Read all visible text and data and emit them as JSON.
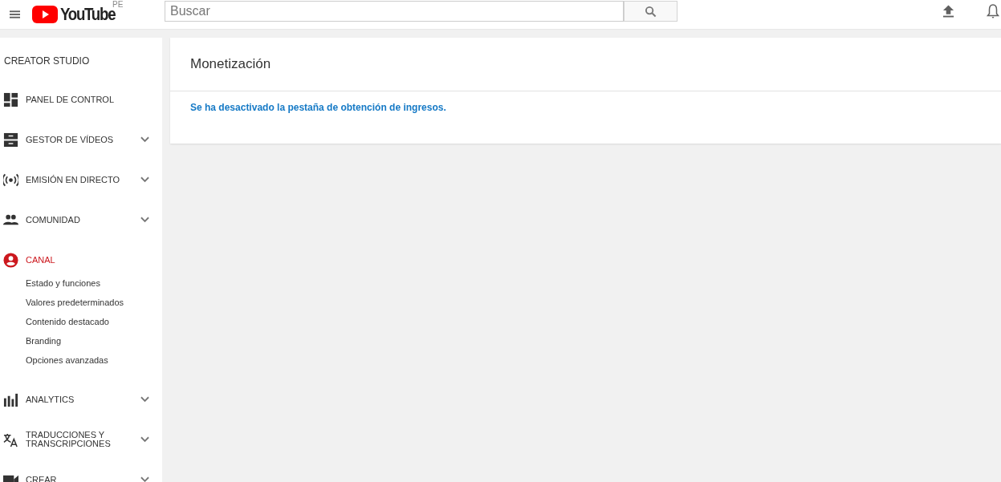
{
  "header": {
    "logo_text": "YouTube",
    "region": "PE",
    "search": {
      "placeholder": "Buscar"
    }
  },
  "sidebar": {
    "title": "CREATOR STUDIO",
    "items": [
      {
        "label": "PANEL DE CONTROL",
        "selected": false,
        "expandable": false
      },
      {
        "label": "GESTOR DE VÍDEOS",
        "selected": false,
        "expandable": true
      },
      {
        "label": "EMISIÓN EN DIRECTO",
        "selected": false,
        "expandable": true
      },
      {
        "label": "COMUNIDAD",
        "selected": false,
        "expandable": true
      },
      {
        "label": "CANAL",
        "selected": true,
        "expandable": false,
        "children": [
          {
            "label": "Estado y funciones"
          },
          {
            "label": "Valores predeterminados"
          },
          {
            "label": "Contenido destacado"
          },
          {
            "label": "Branding"
          },
          {
            "label": "Opciones avanzadas"
          }
        ]
      },
      {
        "label": "ANALYTICS",
        "selected": false,
        "expandable": true
      },
      {
        "label": "TRADUCCIONES Y TRANSCRIPCIONES",
        "selected": false,
        "expandable": true
      },
      {
        "label": "CREAR",
        "selected": false,
        "expandable": true
      }
    ]
  },
  "content": {
    "title": "Monetización",
    "message": "Se ha desactivado la pestaña de obtención de ingresos."
  }
}
